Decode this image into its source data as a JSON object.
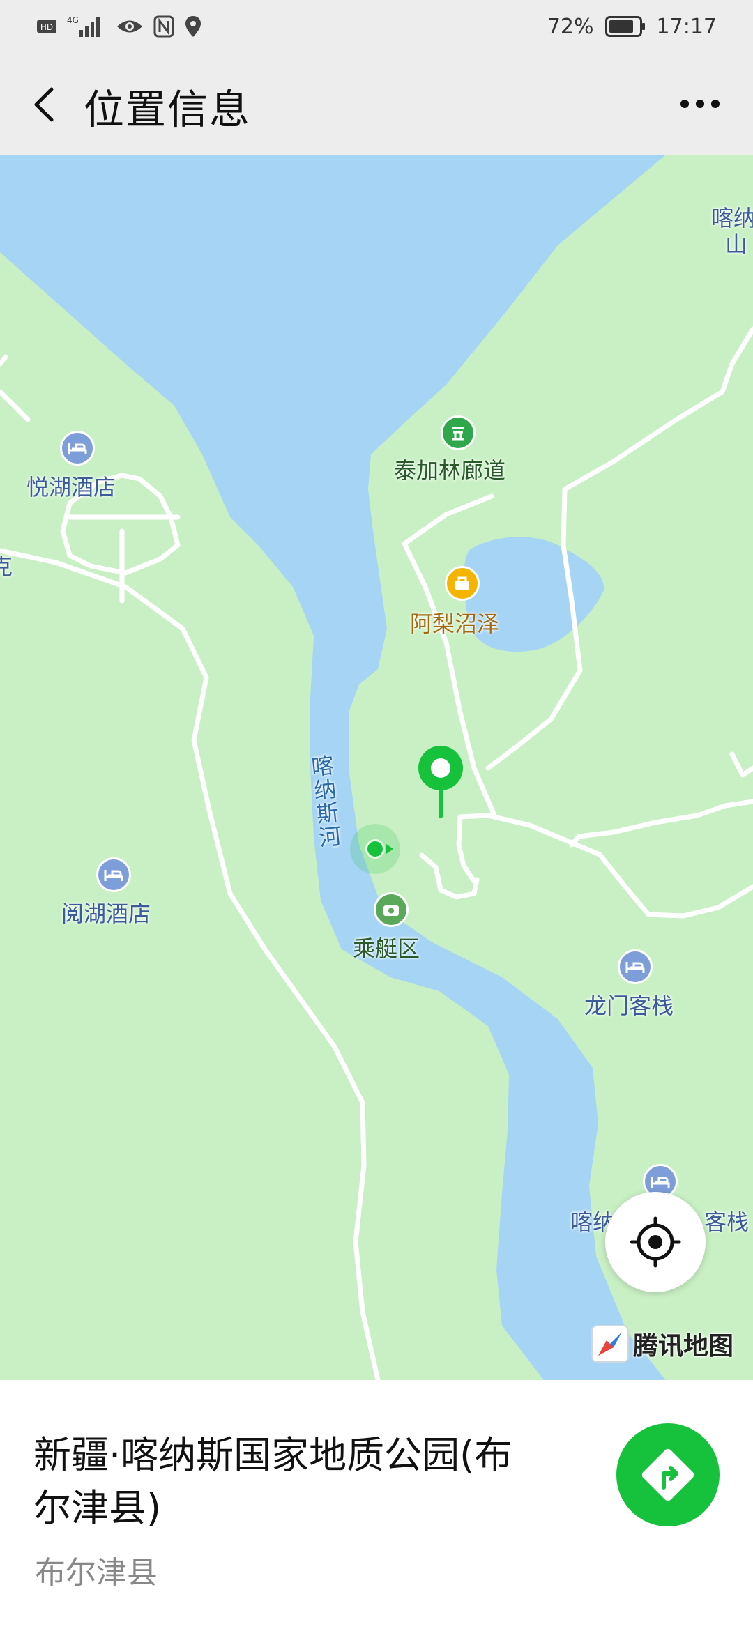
{
  "status_bar": {
    "left_icons": [
      "hd-icon",
      "4g-signal-icon",
      "eye-icon",
      "nfc-icon",
      "location-icon"
    ],
    "battery": "72%",
    "time": "17:17"
  },
  "header": {
    "title": "位置信息",
    "back_icon": "chevron-left-icon",
    "more_icon": "more-dots-icon"
  },
  "map": {
    "labels": {
      "taijialin": "泰加林廊道",
      "yuehu_hotel": "悦湖酒店",
      "yuehu_hotel2": "阅湖酒店",
      "ali_swamp": "阿梨沼泽",
      "river": "喀纳斯河",
      "boat_area": "乘艇区",
      "longmen": "龙门客栈",
      "kanas_inn_a": "喀纳",
      "kanas_inn_b": "客栈",
      "top_right_a": "喀纳",
      "top_right_b": "山",
      "left_edge": "克"
    },
    "provider": "腾讯地图",
    "colors": {
      "land": "#c9f0c4",
      "water": "#a6d4f5",
      "road": "#ffffff",
      "marker": "#16c23c"
    }
  },
  "place": {
    "name": "新疆·喀纳斯国家地质公园(布尔津县)",
    "subtitle": "布尔津县"
  },
  "buttons": {
    "locate_icon": "crosshair-icon",
    "navigate_icon": "navigation-arrow-icon"
  }
}
